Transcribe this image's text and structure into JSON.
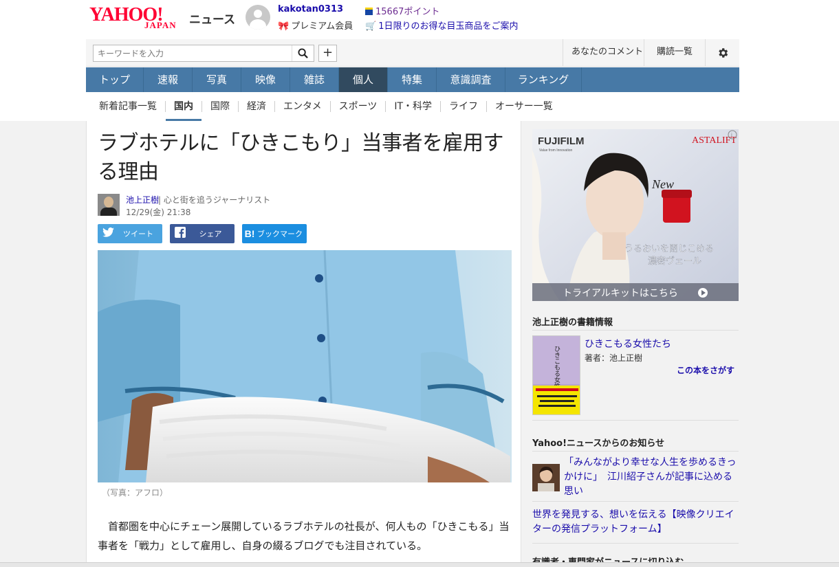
{
  "header": {
    "logo_main": "YAHOO!",
    "logo_sub": "JAPAN",
    "logo_news": "ニュース",
    "username": "kakotan0313",
    "premium": "プレミアム会員",
    "points": "15667ポイント",
    "promo": "1日限りのお得な目玉商品をご案内"
  },
  "toolbar": {
    "search_placeholder": "キーワードを入力",
    "plus": "+",
    "my_comments": "あなたのコメント",
    "subscriptions": "購読一覧"
  },
  "global_nav": [
    "トップ",
    "速報",
    "写真",
    "映像",
    "雑誌",
    "個人",
    "特集",
    "意識調査",
    "ランキング"
  ],
  "global_nav_active": "個人",
  "sub_nav": [
    "新着記事一覧",
    "国内",
    "国際",
    "経済",
    "エンタメ",
    "スポーツ",
    "IT・科学",
    "ライフ",
    "オーサー一覧"
  ],
  "sub_nav_active": "国内",
  "article": {
    "title": "ラブホテルに「ひきこもり」当事者を雇用する理由",
    "author_name": "池上正樹",
    "author_desc": "| 心と街を追うジャーナリスト",
    "date": "12/29(金) 21:38",
    "share_tweet": "ツイート",
    "share_facebook": "シェア",
    "share_hatena": "ブックマーク",
    "photo_caption": "（写真：アフロ）",
    "body": "首都圏を中心にチェーン展開しているラブホテルの社長が、何人もの「ひきこもる」当事者を「戦力」として雇用し、自身の綴るブログでも注目されている。"
  },
  "sidebar": {
    "ad": {
      "brand": "FUJIFILM",
      "brand_tag": "Value from Innovation",
      "product": "ASTALIFT",
      "new": "New",
      "copy_1": "うるおいを閉じこめる",
      "copy_2": "濃密ヴェール",
      "cta": "トライアルキットはこちら"
    },
    "books_heading": "池上正樹の書籍情報",
    "book_title": "ひきこもる女性たち",
    "book_author": "著者：池上正樹",
    "book_find": "この本をさがす",
    "notice_heading": "Yahoo!ニュースからのお知らせ",
    "notice_1": "「みんながより幸せな人生を歩めるきっかけに」　江川紹子さんが記事に込める思い",
    "notice_2": "世界を発見する、想いを伝える【映像クリエイターの発信プラットフォーム】",
    "cut_heading": "有識者・専門家がニュースに切り込む"
  },
  "colors": {
    "brand_red": "#ff0033",
    "nav_blue": "#4779a6",
    "nav_active": "#314a5f",
    "link_blue": "#1a0dab",
    "twitter": "#4aa3df",
    "facebook": "#3b5998",
    "hatena": "#1b8ee0"
  },
  "icons": [
    "search-icon",
    "plus-icon",
    "gear-icon",
    "twitter-icon",
    "facebook-icon",
    "hatena-icon",
    "play-icon",
    "info-icon"
  ]
}
